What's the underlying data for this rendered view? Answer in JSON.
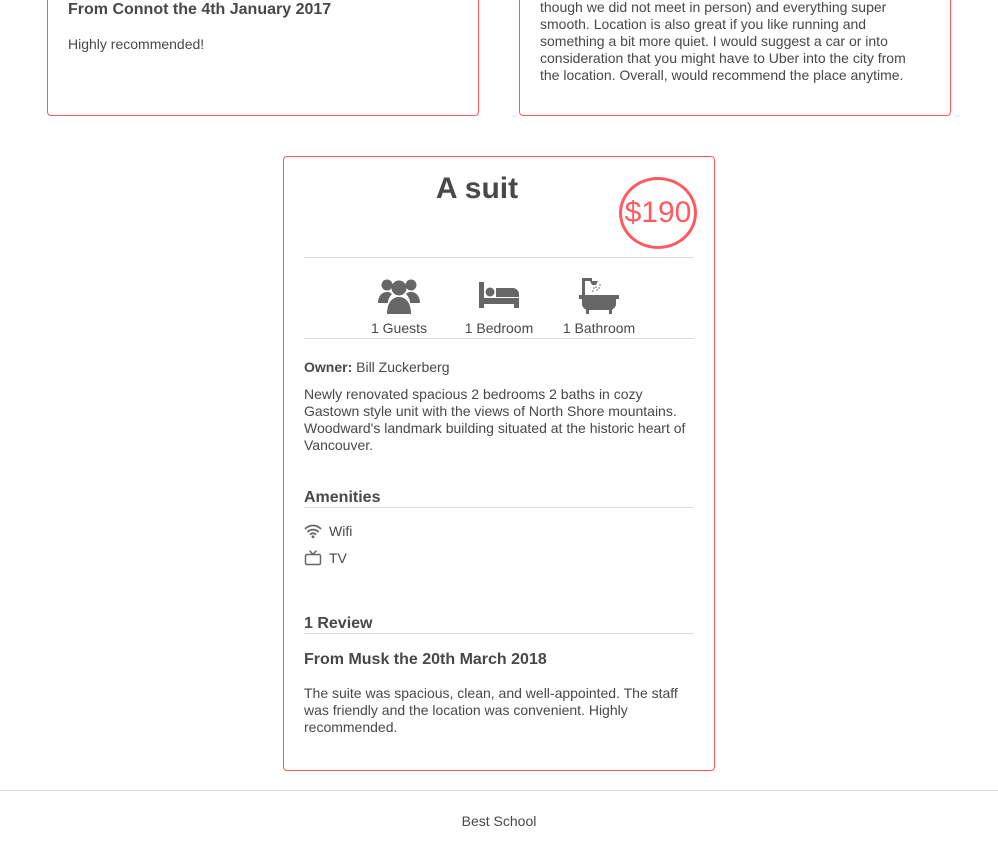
{
  "reviews_top": [
    {
      "title": "From Connot the 4th January 2017",
      "text": "Highly recommended!"
    },
    {
      "text_lines": [
        "though we did not meet in person) and everything super",
        "smooth. Location is also great if you like running and",
        "something a bit more quiet. I would suggest a car or into",
        "consideration that you might have to Uber into the city from",
        "the location. Overall, would recommend the place anytime."
      ]
    }
  ],
  "place": {
    "name": "A suit",
    "price": "$190",
    "stats": [
      {
        "label": "1 Guests",
        "icon": "users-icon"
      },
      {
        "label": "1 Bedroom",
        "icon": "bed-icon"
      },
      {
        "label": "1 Bathroom",
        "icon": "bathtub-icon"
      }
    ],
    "owner_label": "Owner:",
    "owner_name": "Bill Zuckerberg",
    "description": "Newly renovated spacious 2 bedrooms 2 baths in cozy Gastown style unit with the views of North Shore mountains. Woodward's landmark building situated at the historic heart of Vancouver.",
    "amenities_heading": "Amenities",
    "amenities": [
      {
        "label": "Wifi",
        "icon": "wifi-icon"
      },
      {
        "label": "TV",
        "icon": "tv-icon"
      }
    ],
    "reviews_heading": "1 Review",
    "review": {
      "title": "From Musk the 20th March 2018",
      "text": "The suite was spacious, clean, and well-appointed. The staff was friendly and the location was convenient. Highly recommended."
    }
  },
  "footer": {
    "text": "Best School"
  },
  "colors": {
    "accent": "#ff5a5f",
    "text": "#484848",
    "divider": "#dddddd",
    "icon": "#666666"
  }
}
